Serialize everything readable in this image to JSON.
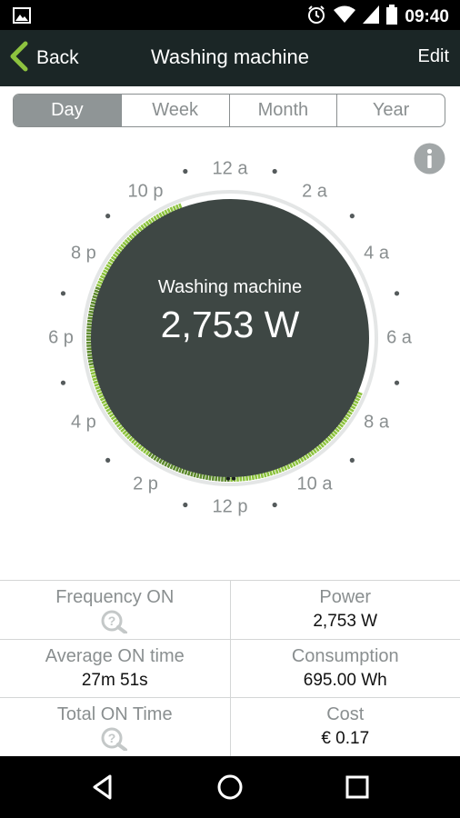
{
  "status_bar": {
    "time": "09:40",
    "icons": [
      "image-icon",
      "alarm-icon",
      "wifi-icon",
      "signal-icon",
      "battery-icon"
    ]
  },
  "app_bar": {
    "back_label": "Back",
    "title": "Washing machine",
    "edit_label": "Edit"
  },
  "tabs": [
    {
      "label": "Day",
      "active": true
    },
    {
      "label": "Week",
      "active": false
    },
    {
      "label": "Month",
      "active": false
    },
    {
      "label": "Year",
      "active": false
    }
  ],
  "clock": {
    "device_name": "Washing machine",
    "power_reading": "2,753 W",
    "hour_labels": [
      "12 a",
      "2 a",
      "4 a",
      "6 a",
      "8 a",
      "10 a",
      "12 p",
      "2 p",
      "4 p",
      "6 p",
      "8 p",
      "10 p"
    ]
  },
  "stats": {
    "frequency": {
      "label": "Frequency ON"
    },
    "power": {
      "label": "Power",
      "value": "2,753 W"
    },
    "average_on": {
      "label": "Average ON time",
      "value": "27m 51s"
    },
    "consumption": {
      "label": "Consumption",
      "value": "695.00 Wh"
    },
    "total_on": {
      "label": "Total ON Time"
    },
    "cost": {
      "label": "Cost",
      "value": "€ 0.17"
    }
  },
  "colors": {
    "appbar": "#1b2626",
    "dial": "#3e4744",
    "accent": "#8dc23f",
    "accent_dark": "#5e8a2e",
    "ring": "#e4e6e6",
    "label_gray": "#8a8f90"
  }
}
